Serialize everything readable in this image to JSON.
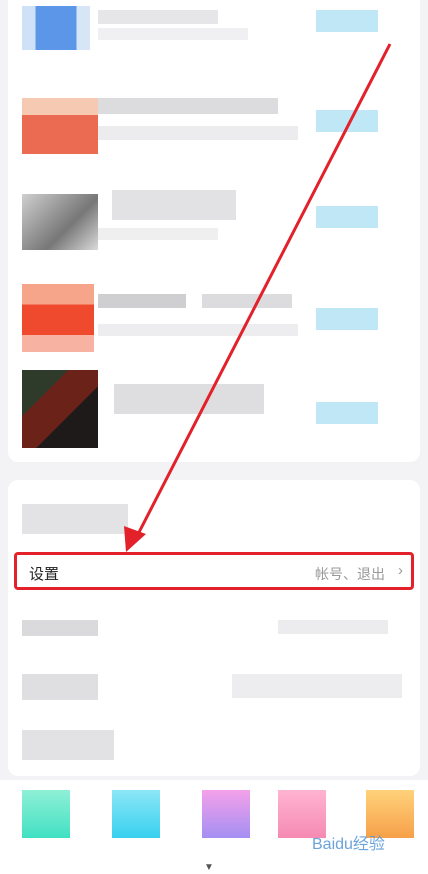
{
  "settings": {
    "label": "设置",
    "sub_label": "帐号、退出",
    "chevron": "›"
  },
  "watermark": {
    "text": "Baidu经验"
  },
  "colors": {
    "highlight_border": "#e2212a",
    "arrow": "#e2212a",
    "action_pill": "#bfe7f6"
  }
}
